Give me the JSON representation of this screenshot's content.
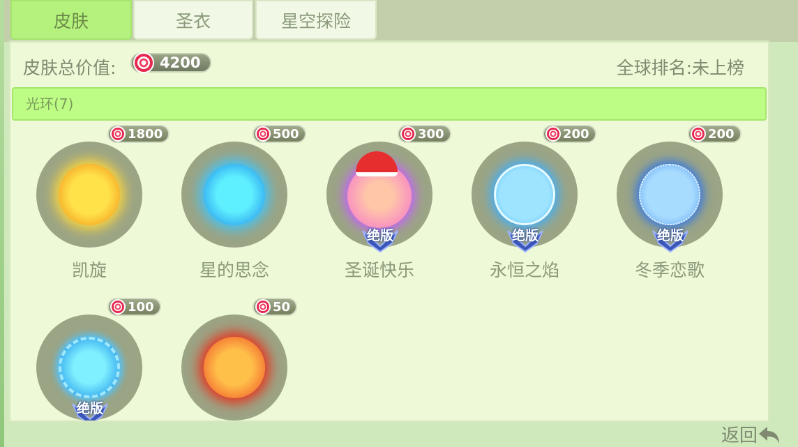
{
  "tabs": [
    {
      "label": "皮肤",
      "active": true
    },
    {
      "label": "圣衣",
      "active": false
    },
    {
      "label": "星空探险",
      "active": false
    }
  ],
  "summary": {
    "total_label": "皮肤总价值:",
    "total_value": "4200",
    "rank_label": "全球排名:未上榜"
  },
  "category": {
    "label": "光环(7)"
  },
  "items": [
    {
      "name": "凯旋",
      "price": "1800",
      "limited": false,
      "color_inner": "#ffe14a",
      "color_outer": "#f08a12"
    },
    {
      "name": "星的思念",
      "price": "500",
      "limited": false,
      "color_inner": "#5ff0ff",
      "color_outer": "#1a86e8"
    },
    {
      "name": "圣诞快乐",
      "price": "300",
      "limited": true,
      "color_inner": "#ffb6d6",
      "color_outer": "#f46fd0"
    },
    {
      "name": "永恒之焰",
      "price": "200",
      "limited": true,
      "color_inner": "#9fe4ff",
      "color_outer": "#52b8ff"
    },
    {
      "name": "冬季恋歌",
      "price": "200",
      "limited": true,
      "color_inner": "#a8dcff",
      "color_outer": "#5a9ef0"
    },
    {
      "name": "",
      "price": "100",
      "limited": true,
      "color_inner": "#7ff0ff",
      "color_outer": "#1c8ee6"
    },
    {
      "name": "",
      "price": "50",
      "limited": false,
      "color_inner": "#ffc04a",
      "color_outer": "#ee4a24"
    }
  ],
  "badge_text": "绝版",
  "back_label": "返回"
}
